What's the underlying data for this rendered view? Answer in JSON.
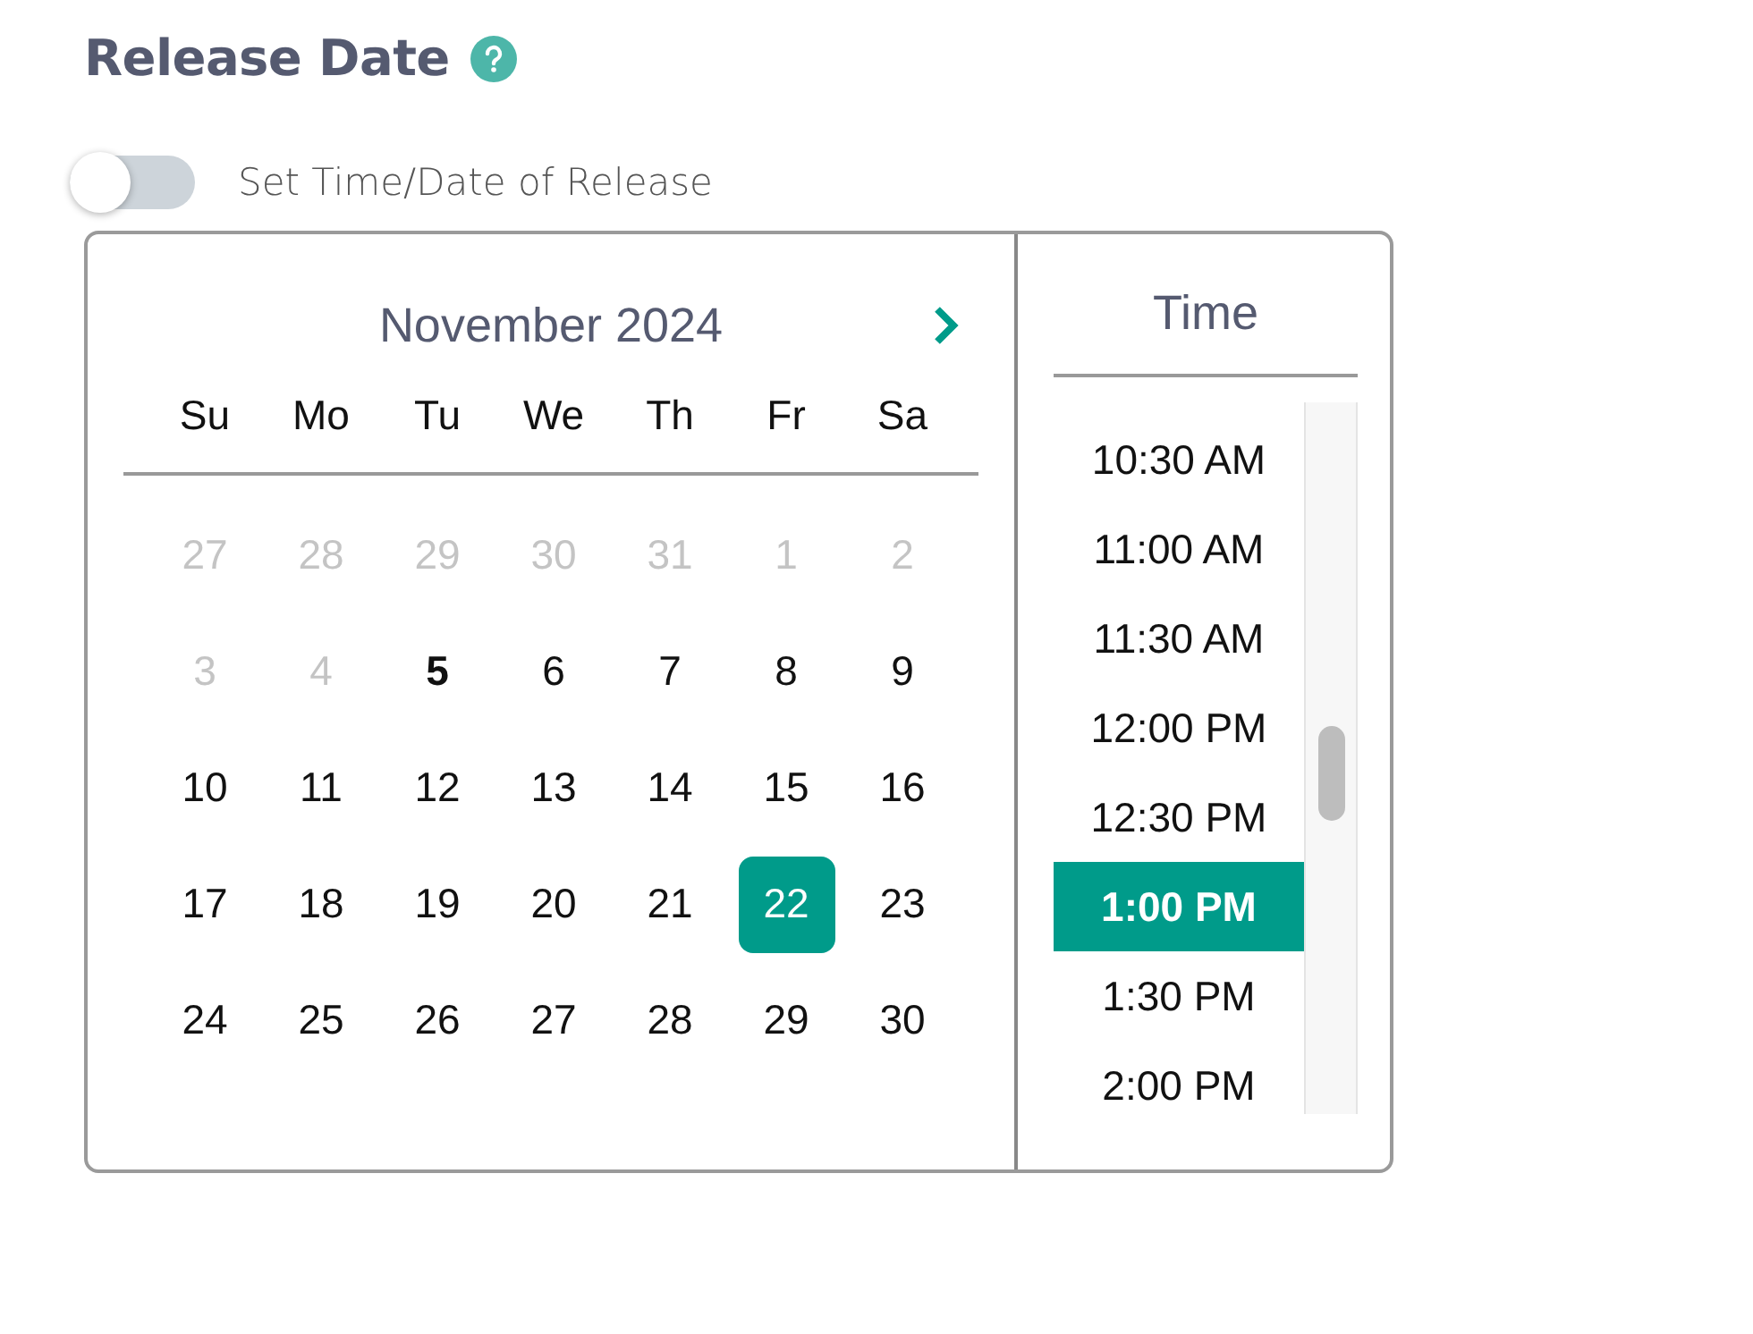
{
  "title": "Release Date",
  "toggle": {
    "label": "Set Time/Date of Release",
    "on": false
  },
  "calendar": {
    "month": "November 2024",
    "weekdays": [
      "Su",
      "Mo",
      "Tu",
      "We",
      "Th",
      "Fr",
      "Sa"
    ],
    "days": [
      {
        "label": "27",
        "disabled": true,
        "today": false,
        "selected": false
      },
      {
        "label": "28",
        "disabled": true,
        "today": false,
        "selected": false
      },
      {
        "label": "29",
        "disabled": true,
        "today": false,
        "selected": false
      },
      {
        "label": "30",
        "disabled": true,
        "today": false,
        "selected": false
      },
      {
        "label": "31",
        "disabled": true,
        "today": false,
        "selected": false
      },
      {
        "label": "1",
        "disabled": true,
        "today": false,
        "selected": false
      },
      {
        "label": "2",
        "disabled": true,
        "today": false,
        "selected": false
      },
      {
        "label": "3",
        "disabled": true,
        "today": false,
        "selected": false
      },
      {
        "label": "4",
        "disabled": true,
        "today": false,
        "selected": false
      },
      {
        "label": "5",
        "disabled": false,
        "today": true,
        "selected": false
      },
      {
        "label": "6",
        "disabled": false,
        "today": false,
        "selected": false
      },
      {
        "label": "7",
        "disabled": false,
        "today": false,
        "selected": false
      },
      {
        "label": "8",
        "disabled": false,
        "today": false,
        "selected": false
      },
      {
        "label": "9",
        "disabled": false,
        "today": false,
        "selected": false
      },
      {
        "label": "10",
        "disabled": false,
        "today": false,
        "selected": false
      },
      {
        "label": "11",
        "disabled": false,
        "today": false,
        "selected": false
      },
      {
        "label": "12",
        "disabled": false,
        "today": false,
        "selected": false
      },
      {
        "label": "13",
        "disabled": false,
        "today": false,
        "selected": false
      },
      {
        "label": "14",
        "disabled": false,
        "today": false,
        "selected": false
      },
      {
        "label": "15",
        "disabled": false,
        "today": false,
        "selected": false
      },
      {
        "label": "16",
        "disabled": false,
        "today": false,
        "selected": false
      },
      {
        "label": "17",
        "disabled": false,
        "today": false,
        "selected": false
      },
      {
        "label": "18",
        "disabled": false,
        "today": false,
        "selected": false
      },
      {
        "label": "19",
        "disabled": false,
        "today": false,
        "selected": false
      },
      {
        "label": "20",
        "disabled": false,
        "today": false,
        "selected": false
      },
      {
        "label": "21",
        "disabled": false,
        "today": false,
        "selected": false
      },
      {
        "label": "22",
        "disabled": false,
        "today": false,
        "selected": true
      },
      {
        "label": "23",
        "disabled": false,
        "today": false,
        "selected": false
      },
      {
        "label": "24",
        "disabled": false,
        "today": false,
        "selected": false
      },
      {
        "label": "25",
        "disabled": false,
        "today": false,
        "selected": false
      },
      {
        "label": "26",
        "disabled": false,
        "today": false,
        "selected": false
      },
      {
        "label": "27",
        "disabled": false,
        "today": false,
        "selected": false
      },
      {
        "label": "28",
        "disabled": false,
        "today": false,
        "selected": false
      },
      {
        "label": "29",
        "disabled": false,
        "today": false,
        "selected": false
      },
      {
        "label": "30",
        "disabled": false,
        "today": false,
        "selected": false
      }
    ]
  },
  "time": {
    "header": "Time",
    "items": [
      {
        "label": "10:30 AM",
        "selected": false
      },
      {
        "label": "11:00 AM",
        "selected": false
      },
      {
        "label": "11:30 AM",
        "selected": false
      },
      {
        "label": "12:00 PM",
        "selected": false
      },
      {
        "label": "12:30 PM",
        "selected": false
      },
      {
        "label": "1:00 PM",
        "selected": true
      },
      {
        "label": "1:30 PM",
        "selected": false
      },
      {
        "label": "2:00 PM",
        "selected": false
      }
    ]
  }
}
